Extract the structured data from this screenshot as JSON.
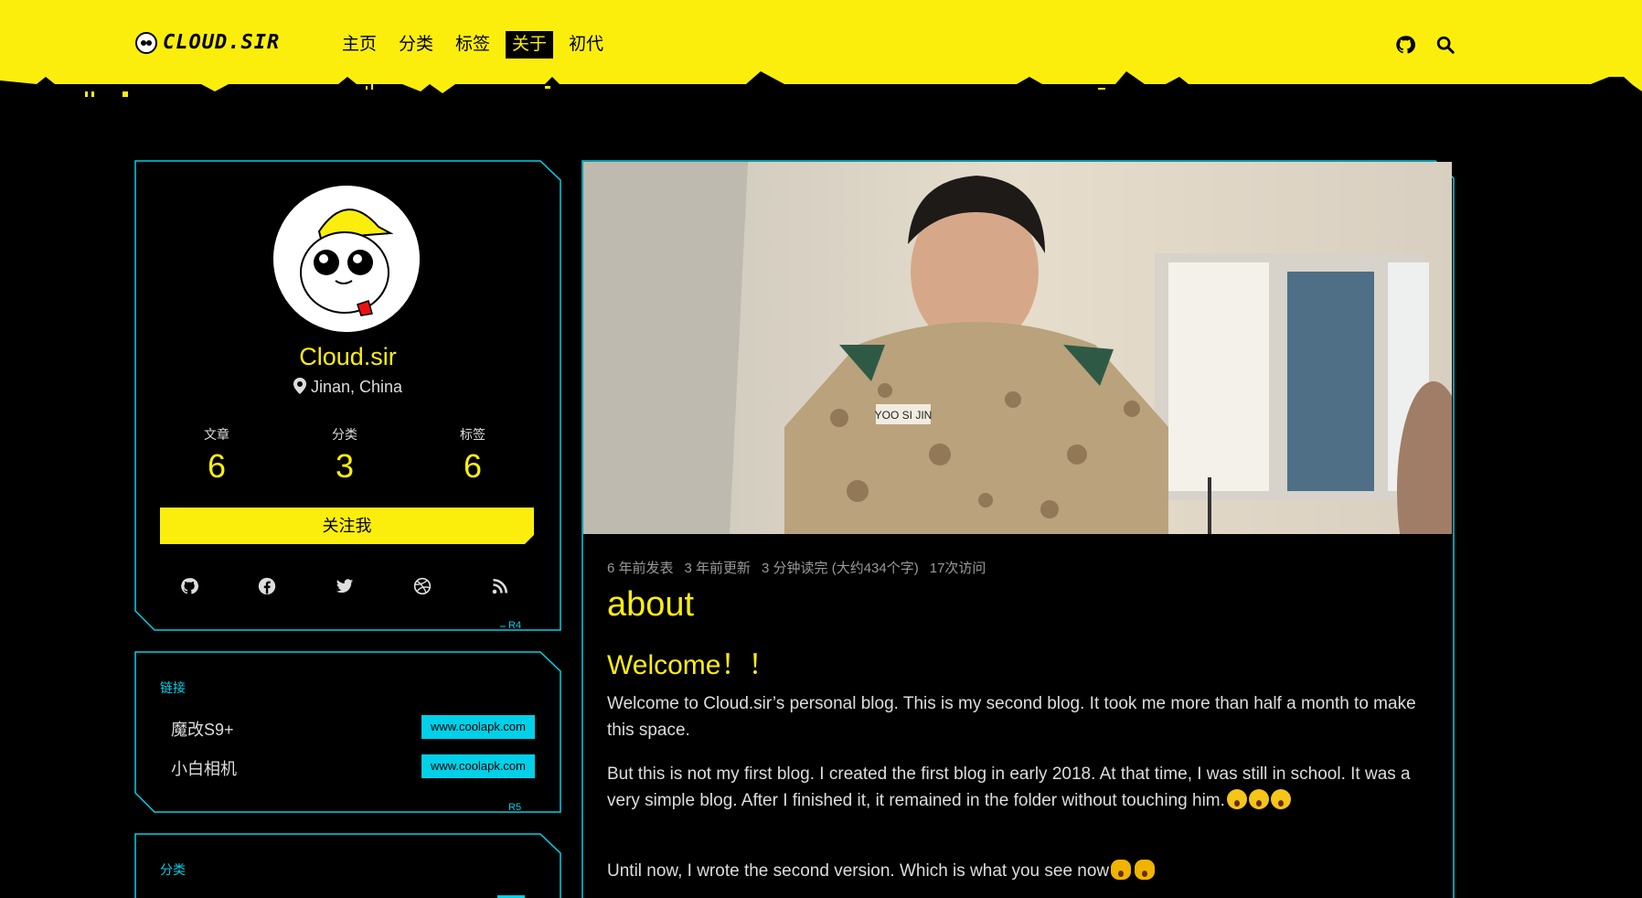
{
  "header": {
    "logo_text": "CLOUD.SIR",
    "nav": [
      "主页",
      "分类",
      "标签",
      "关于",
      "初代"
    ],
    "active_nav": "关于",
    "icons": [
      "github-icon",
      "search-icon"
    ]
  },
  "profile": {
    "name": "Cloud.sir",
    "location": "Jinan, China",
    "stats": [
      {
        "label": "文章",
        "value": "6"
      },
      {
        "label": "分类",
        "value": "3"
      },
      {
        "label": "标签",
        "value": "6"
      }
    ],
    "follow_label": "关注我",
    "socials": [
      "github-icon",
      "facebook-icon",
      "twitter-icon",
      "dribbble-icon",
      "rss-icon"
    ],
    "tag": "R4"
  },
  "links": {
    "title": "链接",
    "items": [
      {
        "name": "魔改S9+",
        "url": "www.coolapk.com"
      },
      {
        "name": "小白相机",
        "url": "www.coolapk.com"
      }
    ],
    "tag": "R5"
  },
  "categories": {
    "title": "分类"
  },
  "post": {
    "meta": [
      "6 年前发表",
      "3 年前更新",
      "3 分钟读完 (大约434个字)",
      "17次访问"
    ],
    "title": "about",
    "heading": "Welcome！！",
    "paragraphs": [
      "Welcome to Cloud.sir’s personal blog. This is my second blog. It took me more than half a month to make this space.",
      "But this is not my first blog. I created the first blog in early 2018. At that time, I was still in school. It was a very simple blog. After I finished it, it remained in the folder without touching him.",
      "Until now, I wrote the second version. Which is what you see now"
    ],
    "hero_badge_text": "YOO SI JIN"
  },
  "colors": {
    "accent": "#fcee0c",
    "cyan": "#00d0e8",
    "background": "#000000"
  }
}
